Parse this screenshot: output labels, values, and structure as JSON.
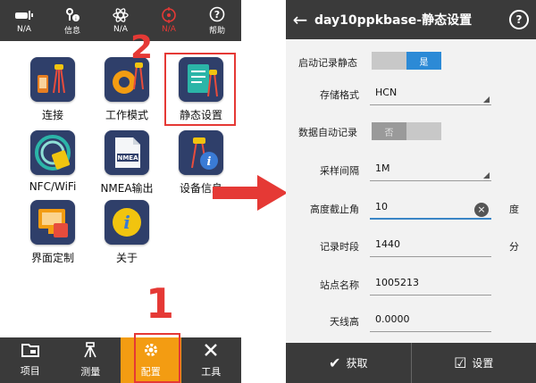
{
  "left": {
    "status_bar": [
      {
        "icon": "satellite-rover-icon",
        "glyph": "▭",
        "label": "N/A"
      },
      {
        "icon": "info-icon",
        "glyph": "⚲",
        "label": "信息"
      },
      {
        "icon": "atom-icon",
        "glyph": "⚛",
        "label": "N/A"
      },
      {
        "icon": "target-icon",
        "glyph": "◎",
        "label": "N/A"
      },
      {
        "icon": "help-icon",
        "glyph": "?",
        "label": "帮助"
      }
    ],
    "apps": [
      {
        "label": "连接"
      },
      {
        "label": "工作模式"
      },
      {
        "label": "静态设置"
      },
      {
        "label": "NFC/WiFi"
      },
      {
        "label": "NMEA输出",
        "badge": "NMEA"
      },
      {
        "label": "设备信息"
      },
      {
        "label": "界面定制"
      },
      {
        "label": "关于"
      }
    ],
    "step_number_1": "1",
    "step_number_2": "2",
    "bottom_nav": [
      {
        "icon": "folder-icon",
        "glyph": "⌂",
        "label": "项目"
      },
      {
        "icon": "measure-icon",
        "glyph": "♙",
        "label": "测量"
      },
      {
        "icon": "gear-icon",
        "glyph": "✿",
        "label": "配置"
      },
      {
        "icon": "tools-icon",
        "glyph": "✕",
        "label": "工具"
      }
    ]
  },
  "right": {
    "title": "day10ppkbase-静态设置",
    "back_glyph": "←",
    "help_glyph": "?",
    "rows": {
      "auto_start_label": "启动记录静态",
      "auto_start_on": "是",
      "storage_format_label": "存储格式",
      "storage_format_value": "HCN",
      "auto_record_label": "数据自动记录",
      "auto_record_off": "否",
      "sample_interval_label": "采样间隔",
      "sample_interval_value": "1M",
      "cutoff_angle_label": "高度截止角",
      "cutoff_angle_value": "10",
      "cutoff_angle_unit": "度",
      "record_period_label": "记录时段",
      "record_period_value": "1440",
      "record_period_unit": "分",
      "station_name_label": "站点名称",
      "station_name_value": "1005213",
      "antenna_height_label": "天线高",
      "antenna_height_value": "0.0000"
    },
    "buttons": {
      "get_label": "获取",
      "get_glyph": "✔",
      "set_label": "设置",
      "set_glyph": "☑"
    }
  },
  "colors": {
    "accent_red": "#e53935",
    "active_orange": "#f39c12",
    "toggle_blue": "#2c8ad6",
    "bar_dark": "#3a3a3a"
  }
}
